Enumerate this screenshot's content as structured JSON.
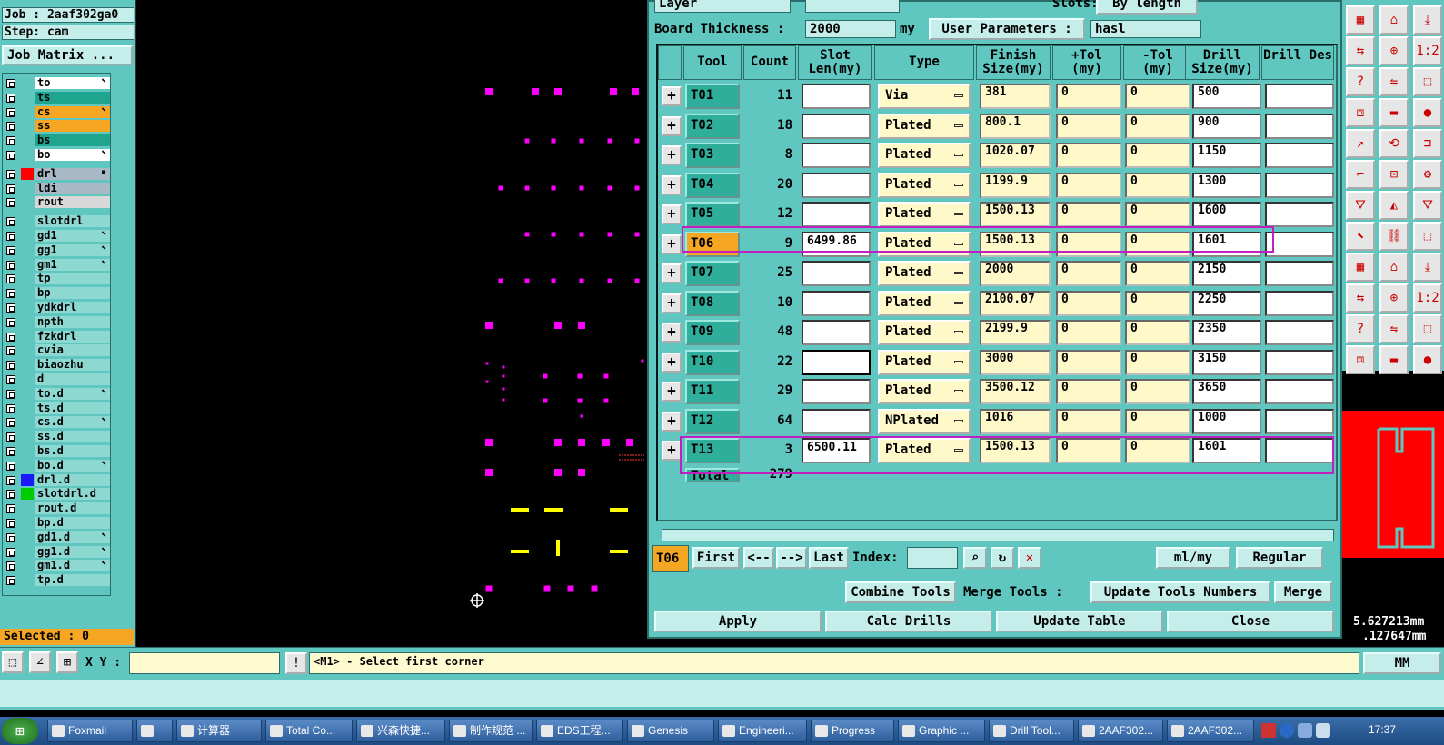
{
  "left_panel": {
    "job": "Job : 2aaf302ga0",
    "step": "Step: cam",
    "job_matrix_btn": "Job Matrix ...",
    "selected": "Selected : 0",
    "layers": [
      {
        "name": "to",
        "color": "#ffffff",
        "edit": "⬉"
      },
      {
        "name": "ts",
        "color": "#1fa58f",
        "edit": ""
      },
      {
        "name": "cs",
        "color": "#f5a623",
        "edit": "⬉"
      },
      {
        "name": "ss",
        "color": "#f5a623",
        "edit": ""
      },
      {
        "name": "bs",
        "color": "#1fa58f",
        "edit": ""
      },
      {
        "name": "bo",
        "color": "#ffffff",
        "edit": "⬉"
      },
      {
        "name": "drl",
        "color": "#a8b8c4",
        "edit": "▪"
      },
      {
        "name": "ldi",
        "color": "#a8b8c4",
        "edit": ""
      },
      {
        "name": "rout",
        "color": "#d8d8d8",
        "edit": ""
      },
      {
        "name": "slotdrl",
        "color": "#8ed8d2",
        "edit": ""
      },
      {
        "name": "gd1",
        "color": "#8ed8d2",
        "edit": "⬉"
      },
      {
        "name": "gg1",
        "color": "#8ed8d2",
        "edit": "⬉"
      },
      {
        "name": "gm1",
        "color": "#8ed8d2",
        "edit": "⬉"
      },
      {
        "name": "tp",
        "color": "#8ed8d2",
        "edit": ""
      },
      {
        "name": "bp",
        "color": "#8ed8d2",
        "edit": ""
      },
      {
        "name": "ydkdrl",
        "color": "#8ed8d2",
        "edit": ""
      },
      {
        "name": "npth",
        "color": "#8ed8d2",
        "edit": ""
      },
      {
        "name": "fzkdrl",
        "color": "#8ed8d2",
        "edit": ""
      },
      {
        "name": "cvia",
        "color": "#8ed8d2",
        "edit": ""
      },
      {
        "name": "biaozhu",
        "color": "#8ed8d2",
        "edit": ""
      },
      {
        "name": "d",
        "color": "#8ed8d2",
        "edit": ""
      },
      {
        "name": "to.d",
        "color": "#8ed8d2",
        "edit": "⬉"
      },
      {
        "name": "ts.d",
        "color": "#8ed8d2",
        "edit": ""
      },
      {
        "name": "cs.d",
        "color": "#8ed8d2",
        "edit": "⬉"
      },
      {
        "name": "ss.d",
        "color": "#8ed8d2",
        "edit": ""
      },
      {
        "name": "bs.d",
        "color": "#8ed8d2",
        "edit": ""
      },
      {
        "name": "bo.d",
        "color": "#8ed8d2",
        "edit": "⬉"
      },
      {
        "name": "drl.d",
        "color": "#8ed8d2",
        "edit": ""
      },
      {
        "name": "slotdrl.d",
        "color": "#8ed8d2",
        "edit": ""
      },
      {
        "name": "rout.d",
        "color": "#8ed8d2",
        "edit": ""
      },
      {
        "name": "bp.d",
        "color": "#8ed8d2",
        "edit": ""
      },
      {
        "name": "gd1.d",
        "color": "#8ed8d2",
        "edit": "⬉"
      },
      {
        "name": "gg1.d",
        "color": "#8ed8d2",
        "edit": "⬉"
      },
      {
        "name": "gm1.d",
        "color": "#8ed8d2",
        "edit": "⬉"
      },
      {
        "name": "tp.d",
        "color": "#8ed8d2",
        "edit": ""
      }
    ]
  },
  "dialog": {
    "layer_label": "Layer",
    "board_thickness_label": "Board Thickness :",
    "board_thickness_value": "2000",
    "board_thickness_unit": "my",
    "user_params_label": "User Parameters :",
    "user_params_value": "hasl",
    "slots_label": "Slots:",
    "slots_value": "By length",
    "headers": [
      "Tool",
      "Count",
      "Slot Len(my)",
      "Type",
      "Finish Size(my)",
      "+Tol (my)",
      "-Tol (my)",
      "Drill Size(my)",
      "Drill Des"
    ],
    "rows": [
      {
        "tool": "T01",
        "count": "11",
        "slot": "",
        "type": "Via",
        "finish": "381",
        "ptol": "0",
        "mtol": "0",
        "drill": "500"
      },
      {
        "tool": "T02",
        "count": "18",
        "slot": "",
        "type": "Plated",
        "finish": "800.1",
        "ptol": "0",
        "mtol": "0",
        "drill": "900"
      },
      {
        "tool": "T03",
        "count": "8",
        "slot": "",
        "type": "Plated",
        "finish": "1020.07",
        "ptol": "0",
        "mtol": "0",
        "drill": "1150"
      },
      {
        "tool": "T04",
        "count": "20",
        "slot": "",
        "type": "Plated",
        "finish": "1199.9",
        "ptol": "0",
        "mtol": "0",
        "drill": "1300"
      },
      {
        "tool": "T05",
        "count": "12",
        "slot": "",
        "type": "Plated",
        "finish": "1500.13",
        "ptol": "0",
        "mtol": "0",
        "drill": "1600"
      },
      {
        "tool": "T06",
        "count": "9",
        "slot": "6499.86",
        "type": "Plated",
        "finish": "1500.13",
        "ptol": "0",
        "mtol": "0",
        "drill": "1601"
      },
      {
        "tool": "T07",
        "count": "25",
        "slot": "",
        "type": "Plated",
        "finish": "2000",
        "ptol": "0",
        "mtol": "0",
        "drill": "2150"
      },
      {
        "tool": "T08",
        "count": "10",
        "slot": "",
        "type": "Plated",
        "finish": "2100.07",
        "ptol": "0",
        "mtol": "0",
        "drill": "2250"
      },
      {
        "tool": "T09",
        "count": "48",
        "slot": "",
        "type": "Plated",
        "finish": "2199.9",
        "ptol": "0",
        "mtol": "0",
        "drill": "2350"
      },
      {
        "tool": "T10",
        "count": "22",
        "slot": "",
        "type": "Plated",
        "finish": "3000",
        "ptol": "0",
        "mtol": "0",
        "drill": "3150"
      },
      {
        "tool": "T11",
        "count": "29",
        "slot": "",
        "type": "Plated",
        "finish": "3500.12",
        "ptol": "0",
        "mtol": "0",
        "drill": "3650"
      },
      {
        "tool": "T12",
        "count": "64",
        "slot": "",
        "type": "NPlated",
        "finish": "1016",
        "ptol": "0",
        "mtol": "0",
        "drill": "1000"
      },
      {
        "tool": "T13",
        "count": "3",
        "slot": "6500.11",
        "type": "Plated",
        "finish": "1500.13",
        "ptol": "0",
        "mtol": "0",
        "drill": "1601"
      }
    ],
    "total_label": "Total",
    "total_count": "279",
    "nav": {
      "current": "T06",
      "first": "First",
      "prev": "<--",
      "next": "-->",
      "last": "Last",
      "index_label": "Index:",
      "units": "ml/my",
      "mode": "Regular"
    },
    "combine_tools": "Combine Tools",
    "merge_tools_label": "Merge Tools :",
    "update_tools_numbers": "Update Tools Numbers",
    "merge": "Merge",
    "apply": "Apply",
    "calc_drills": "Calc Drills",
    "update_table": "Update Table",
    "close": "Close"
  },
  "right": {
    "coord1": "5.627213mm",
    "coord2": ".127647mm"
  },
  "status": {
    "xy_label": "X Y :",
    "xy_value": "",
    "message": "<M1> - Select first corner",
    "units": "MM"
  },
  "taskbar": {
    "items": [
      "Foxmail",
      "",
      "计算器",
      "Total Co...",
      "兴森快捷...",
      "制作规范 ...",
      "EDS工程...",
      "Genesis",
      "Engineeri...",
      "Progress",
      "Graphic ...",
      "Drill Tool...",
      "2AAF302...",
      "2AAF302..."
    ],
    "clock": "17:37",
    "start": "⊞"
  },
  "colors": {
    "panel": "#5fc7c0",
    "dialog_bg": "#5fc7c0",
    "magenta_pads": "#ff00ff",
    "yellow_marks": "#ffff00",
    "highlight": "#c020c0",
    "selected_tool": "#f5a623"
  }
}
